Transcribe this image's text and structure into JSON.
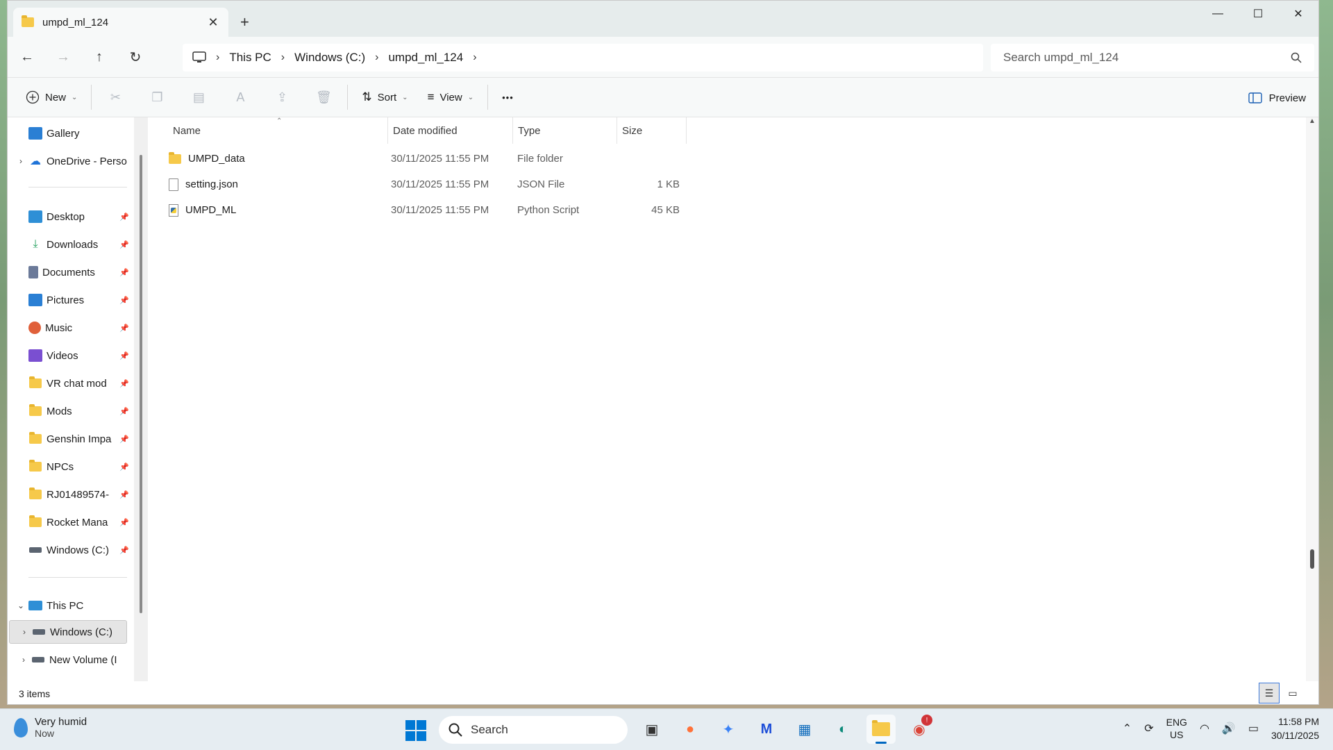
{
  "window": {
    "tab_title": "umpd_ml_124",
    "new_tab_symbol": "+",
    "tab_close_symbol": "✕",
    "controls": {
      "minimize": "—",
      "maximize": "☐",
      "close": "✕"
    }
  },
  "nav": {
    "back": "←",
    "forward": "→",
    "up": "↑",
    "refresh": "↻",
    "breadcrumbs": [
      "This PC",
      "Windows (C:)",
      "umpd_ml_124"
    ],
    "search_placeholder": "Search umpd_ml_124"
  },
  "toolbar": {
    "new_label": "New",
    "sort_label": "Sort",
    "view_label": "View",
    "more_label": "•••",
    "preview_label": "Preview",
    "icons": [
      "cut-icon",
      "copy-icon",
      "paste-icon",
      "rename-icon",
      "share-icon",
      "delete-icon"
    ]
  },
  "sidebar": {
    "top": [
      {
        "label": "Gallery",
        "icon": "gallery-icon",
        "expandable": false
      },
      {
        "label": "OneDrive - Perso",
        "icon": "onedrive-icon",
        "expandable": true
      }
    ],
    "quick_access": [
      {
        "label": "Desktop",
        "icon": "desktop-icon",
        "color": "#2e8fd6"
      },
      {
        "label": "Downloads",
        "icon": "downloads-icon",
        "color": "#1f9e5b"
      },
      {
        "label": "Documents",
        "icon": "documents-icon",
        "color": "#6b7a99"
      },
      {
        "label": "Pictures",
        "icon": "pictures-icon",
        "color": "#2a7fd4"
      },
      {
        "label": "Music",
        "icon": "music-icon",
        "color": "#e0603a"
      },
      {
        "label": "Videos",
        "icon": "videos-icon",
        "color": "#7a4fd1"
      },
      {
        "label": "VR chat mod",
        "icon": "folder-icon"
      },
      {
        "label": "Mods",
        "icon": "folder-icon"
      },
      {
        "label": "Genshin Impa",
        "icon": "folder-icon"
      },
      {
        "label": "NPCs",
        "icon": "folder-icon"
      },
      {
        "label": "RJ01489574-",
        "icon": "folder-icon"
      },
      {
        "label": "Rocket Mana",
        "icon": "folder-icon"
      },
      {
        "label": "Windows (C:)",
        "icon": "drive-icon"
      }
    ],
    "this_pc": {
      "label": "This PC"
    },
    "drives": [
      {
        "label": "Windows (C:)",
        "selected": true
      },
      {
        "label": "New Volume (I",
        "selected": false
      }
    ]
  },
  "columns": {
    "name": "Name",
    "date": "Date modified",
    "type": "Type",
    "size": "Size"
  },
  "files": [
    {
      "name": "UMPD_data",
      "date": "30/11/2025 11:55 PM",
      "type": "File folder",
      "size": "",
      "icon": "folder-icon"
    },
    {
      "name": "setting.json",
      "date": "30/11/2025 11:55 PM",
      "type": "JSON File",
      "size": "1 KB",
      "icon": "file-icon"
    },
    {
      "name": "UMPD_ML",
      "date": "30/11/2025 11:55 PM",
      "type": "Python Script",
      "size": "45 KB",
      "icon": "python-file-icon"
    }
  ],
  "status": {
    "item_count": "3 items"
  },
  "taskbar": {
    "weather_title": "Very humid",
    "weather_sub": "Now",
    "search_label": "Search",
    "apps": [
      {
        "name": "task-view-icon",
        "glyph": "▣",
        "active": false
      },
      {
        "name": "firefox-icon",
        "glyph": "●",
        "active": false,
        "color": "#ff7139"
      },
      {
        "name": "copilot-icon",
        "glyph": "✦",
        "active": false,
        "color": "#3b82f6"
      },
      {
        "name": "m-app-icon",
        "glyph": "M",
        "active": false,
        "color": "#1d4ed8"
      },
      {
        "name": "store-icon",
        "glyph": "▦",
        "active": false,
        "color": "#0f6cbd"
      },
      {
        "name": "edge-icon",
        "glyph": "◐",
        "active": false,
        "color": "#0c8a7a"
      },
      {
        "name": "file-explorer-icon",
        "glyph": "▬",
        "active": true,
        "color": "#f6c94a"
      },
      {
        "name": "chrome-icon",
        "glyph": "◉",
        "active": false,
        "color": "#db4437"
      }
    ],
    "chrome_badge": "!",
    "lang_top": "ENG",
    "lang_bottom": "US",
    "time": "11:58 PM",
    "date": "30/11/2025"
  }
}
